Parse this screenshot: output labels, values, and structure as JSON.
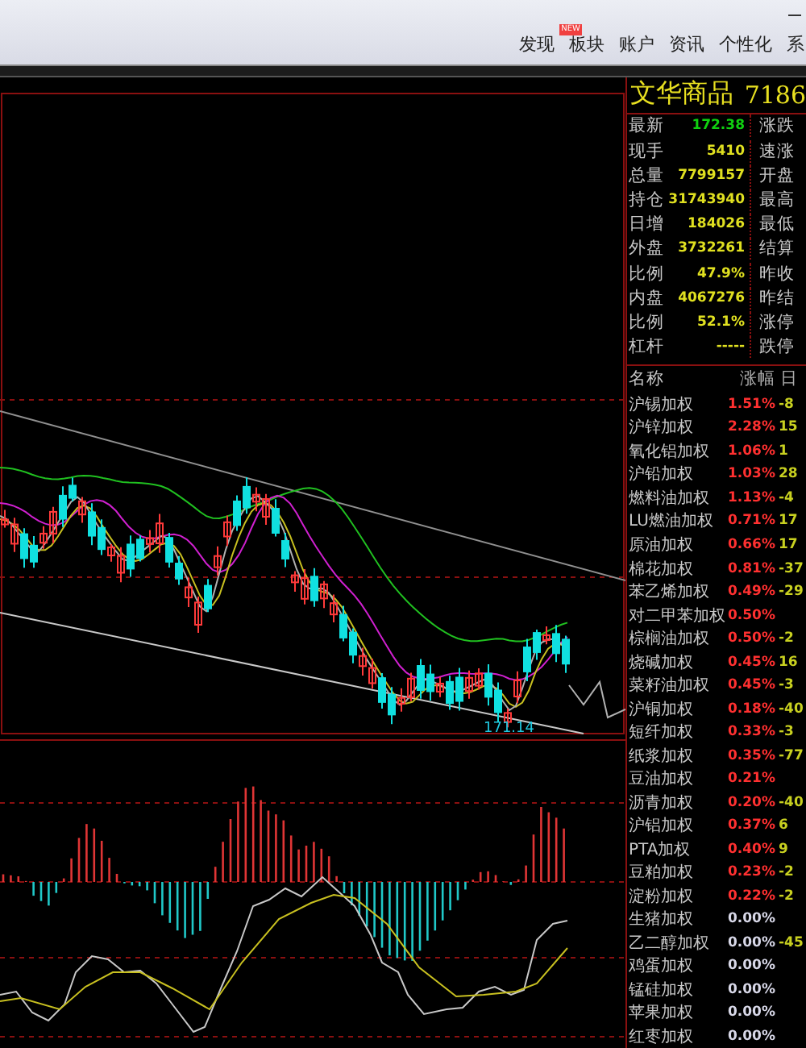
{
  "menu": [
    {
      "label": "发现",
      "badge": "NEW"
    },
    {
      "label": "板块"
    },
    {
      "label": "账户"
    },
    {
      "label": "资讯"
    },
    {
      "label": "个性化"
    },
    {
      "label": "系"
    }
  ],
  "quote": {
    "title": "文华商品",
    "code": "7186",
    "rows": [
      {
        "label": "最新",
        "value": "172.38",
        "color": "#10d010",
        "label2": "涨跌"
      },
      {
        "label": "现手",
        "value": "5410",
        "color": "#e0e020",
        "label2": "速涨"
      },
      {
        "label": "总量",
        "value": "7799157",
        "color": "#e0e020",
        "label2": "开盘"
      },
      {
        "label": "持仓",
        "value": "31743940",
        "color": "#e0e020",
        "label2": "最高"
      },
      {
        "label": "日增",
        "value": "184026",
        "color": "#e0e020",
        "label2": "最低"
      },
      {
        "label": "外盘",
        "value": "3732261",
        "color": "#e0e020",
        "label2": "结算"
      },
      {
        "label": "比例",
        "value": "47.9%",
        "color": "#e0e020",
        "label2": "昨收"
      },
      {
        "label": "内盘",
        "value": "4067276",
        "color": "#e0e020",
        "label2": "昨结"
      },
      {
        "label": "比例",
        "value": "52.1%",
        "color": "#e0e020",
        "label2": "涨停"
      },
      {
        "label": "杠杆",
        "value": "-----",
        "color": "#e0e020",
        "label2": "跌停"
      }
    ]
  },
  "list": {
    "columns": [
      "名称",
      "涨幅",
      "日"
    ],
    "rows": [
      {
        "name": "沪锡加权",
        "change": "1.51%",
        "color": "#ff3030",
        "column_3": "-8"
      },
      {
        "name": "沪锌加权",
        "change": "2.28%",
        "color": "#ff3030",
        "column_3": "15"
      },
      {
        "name": "氧化铝加权",
        "change": "1.06%",
        "color": "#ff3030",
        "column_3": "1"
      },
      {
        "name": "沪铅加权",
        "change": "1.03%",
        "color": "#ff3030",
        "column_3": "28"
      },
      {
        "name": "燃料油加权",
        "change": "1.13%",
        "color": "#ff3030",
        "column_3": "-4"
      },
      {
        "name": "LU燃油加权",
        "change": "0.71%",
        "color": "#ff3030",
        "column_3": "17"
      },
      {
        "name": "原油加权",
        "change": "0.66%",
        "color": "#ff3030",
        "column_3": "17"
      },
      {
        "name": "棉花加权",
        "change": "0.81%",
        "color": "#ff3030",
        "column_3": "-37"
      },
      {
        "name": "苯乙烯加权",
        "change": "0.49%",
        "color": "#ff3030",
        "column_3": "-29"
      },
      {
        "name": "对二甲苯加权",
        "change": "0.50%",
        "color": "#ff3030"
      },
      {
        "name": "棕榈油加权",
        "change": "0.50%",
        "color": "#ff3030",
        "column_3": "-2"
      },
      {
        "name": "烧碱加权",
        "change": "0.45%",
        "color": "#ff3030",
        "column_3": "16"
      },
      {
        "name": "菜籽油加权",
        "change": "0.45%",
        "color": "#ff3030",
        "column_3": "-3"
      },
      {
        "name": "沪铜加权",
        "change": "0.18%",
        "color": "#ff3030",
        "column_3": "-40"
      },
      {
        "name": "短纤加权",
        "change": "0.33%",
        "color": "#ff3030",
        "column_3": "-3"
      },
      {
        "name": "纸浆加权",
        "change": "0.35%",
        "color": "#ff3030",
        "column_3": "-77"
      },
      {
        "name": "豆油加权",
        "change": "0.21%",
        "color": "#ff3030"
      },
      {
        "name": "沥青加权",
        "change": "0.20%",
        "color": "#ff3030",
        "column_3": "-40"
      },
      {
        "name": "沪铝加权",
        "change": "0.37%",
        "color": "#ff3030",
        "column_3": "6"
      },
      {
        "name": "PTA加权",
        "change": "0.40%",
        "color": "#ff3030",
        "column_3": "9"
      },
      {
        "name": "豆粕加权",
        "change": "0.23%",
        "color": "#ff3030",
        "column_3": "-2"
      },
      {
        "name": "淀粉加权",
        "change": "0.22%",
        "color": "#ff3030",
        "column_3": "-2"
      },
      {
        "name": "生猪加权",
        "change": "0.00%",
        "color": "#d8d8e8"
      },
      {
        "name": "乙二醇加权",
        "change": "0.00%",
        "color": "#d8d8e8",
        "column_3": "-45"
      },
      {
        "name": "鸡蛋加权",
        "change": "0.00%",
        "color": "#d8d8e8"
      },
      {
        "name": "锰硅加权",
        "change": "0.00%",
        "color": "#d8d8e8"
      },
      {
        "name": "苹果加权",
        "change": "0.00%",
        "color": "#d8d8e8"
      },
      {
        "name": "红枣加权",
        "change": "0.00%",
        "color": "#d8d8e8"
      }
    ]
  },
  "chart": {
    "low_label": "171.14"
  }
}
